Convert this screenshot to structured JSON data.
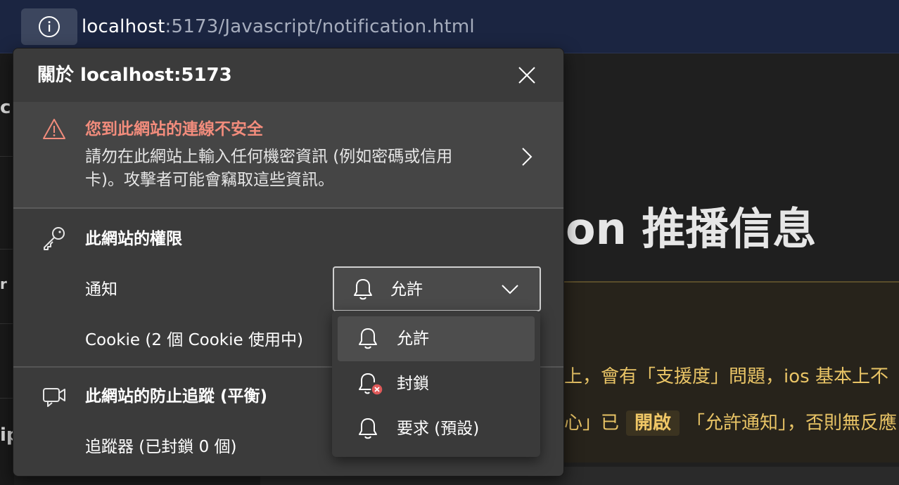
{
  "address_bar": {
    "url_host": "localhost",
    "url_rest": ":5173/Javascript/notification.html",
    "site_info_icon": "info-icon"
  },
  "page": {
    "heading": "on 推播信息",
    "left_fragments": [
      "c",
      "r",
      "ip"
    ],
    "notice_line1": "上，會有「支援度」問題，ios 基本上不",
    "notice_line2_prefix": "心」已",
    "notice_line2_badge": "開啟",
    "notice_line2_suffix": "「允許通知」，否則無反應"
  },
  "panel": {
    "title": "關於 localhost:5173",
    "close_icon": "close-icon",
    "warning": {
      "title": "您到此網站的連線不安全",
      "description": "請勿在此網站上輸入任何機密資訊 (例如密碼或信用卡)。攻擊者可能會竊取這些資訊。",
      "icon": "warning-triangle-icon",
      "accent": "#f28c7c"
    },
    "permissions": {
      "title": "此網站的權限",
      "icon": "key-icon",
      "notification_label": "通知",
      "notification_value": "允許",
      "cookie_label": "Cookie (2 個 Cookie 使用中)"
    },
    "tracking": {
      "title": "此網站的防止追蹤 (平衡)",
      "icon": "tracking-camera-icon",
      "trackers_label": "追蹤器 (已封鎖 0 個)"
    }
  },
  "dropdown": {
    "options": [
      {
        "label": "允許",
        "icon": "bell-icon",
        "selected": true
      },
      {
        "label": "封鎖",
        "icon": "bell-blocked-icon",
        "selected": false
      },
      {
        "label": "要求 (預設)",
        "icon": "bell-icon",
        "selected": false
      }
    ]
  }
}
